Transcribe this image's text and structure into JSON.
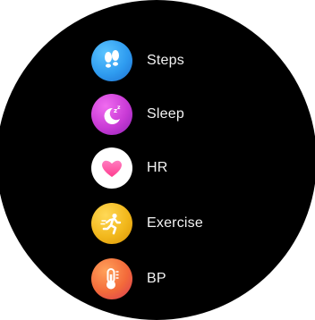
{
  "menu": {
    "items": [
      {
        "label": "Steps",
        "icon": "footprints-icon",
        "color": "#2f9cf0"
      },
      {
        "label": "Sleep",
        "icon": "moon-zz-icon",
        "color": "#c93bd6"
      },
      {
        "label": "HR",
        "icon": "heart-icon",
        "color": "#ff5aa8"
      },
      {
        "label": "Exercise",
        "icon": "runner-icon",
        "color": "#f2b81c"
      },
      {
        "label": "BP",
        "icon": "thermometer-icon",
        "color": "#f36a3a"
      }
    ]
  }
}
